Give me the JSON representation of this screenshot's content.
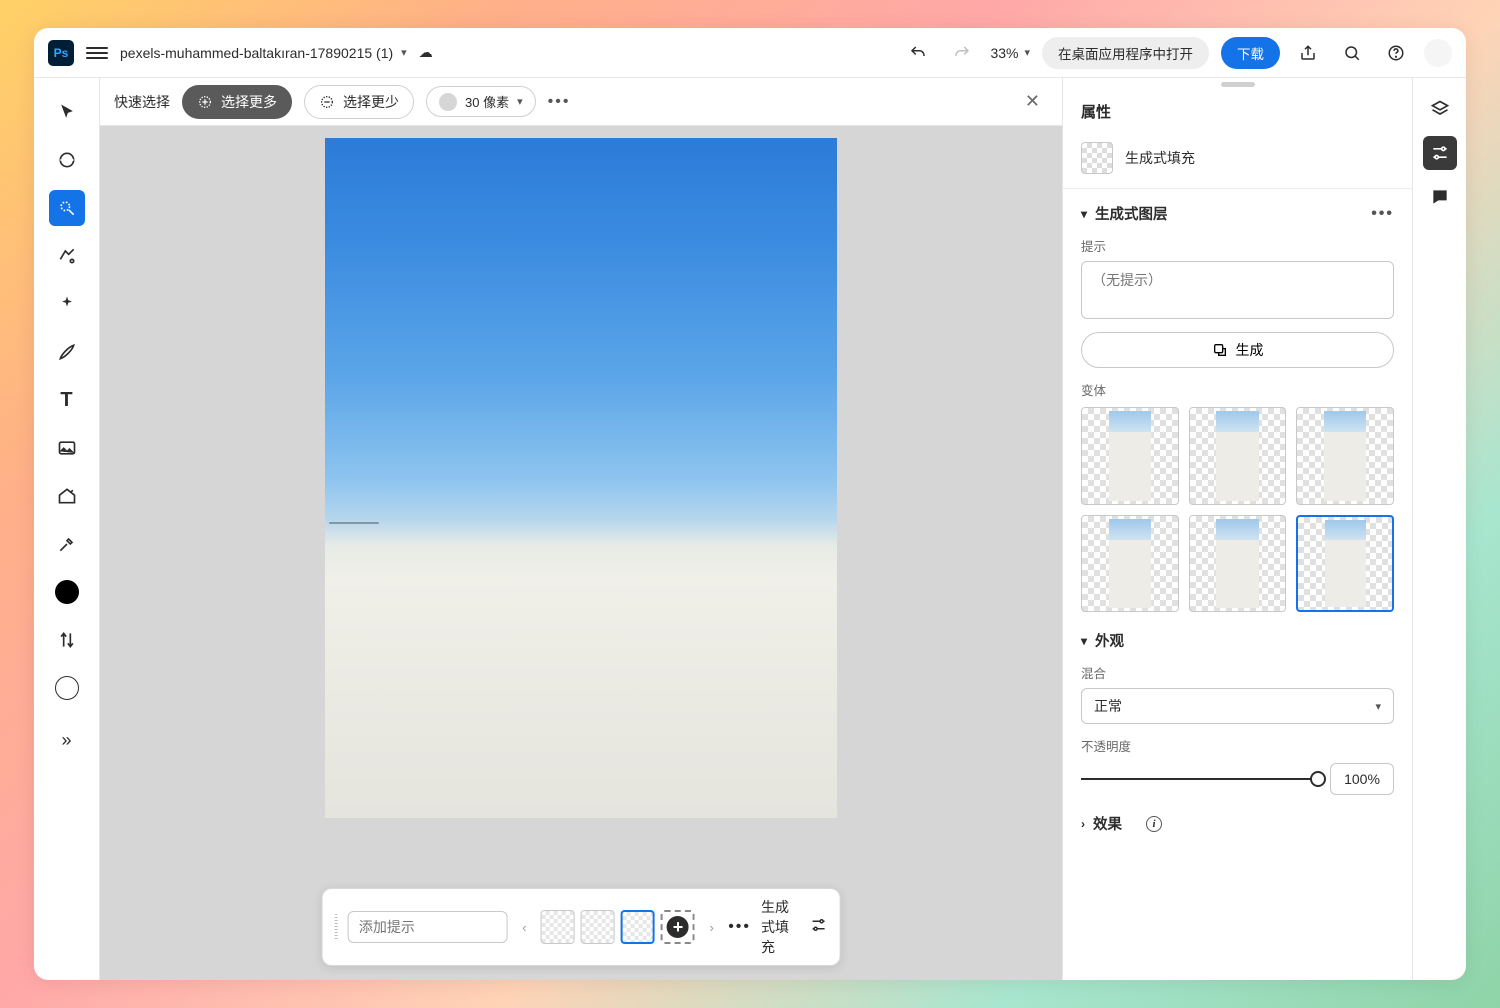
{
  "topbar": {
    "filename": "pexels-muhammed-baltakıran-17890215 (1)",
    "zoom": "33%",
    "open_desktop": "在桌面应用程序中打开",
    "download": "下载"
  },
  "options": {
    "mode_label": "快速选择",
    "select_more": "选择更多",
    "select_less": "选择更少",
    "brush_size": "30 像素"
  },
  "taskbar": {
    "prompt_placeholder": "添加提示",
    "fill_label": "生成式填充"
  },
  "panel": {
    "title": "属性",
    "fill_type": "生成式填充",
    "gen_layer_header": "生成式图层",
    "prompt_label": "提示",
    "prompt_placeholder": "（无提示）",
    "generate": "生成",
    "variants_label": "变体",
    "appearance_header": "外观",
    "blend_label": "混合",
    "blend_value": "正常",
    "opacity_label": "不透明度",
    "opacity_value": "100%",
    "effects_header": "效果"
  }
}
